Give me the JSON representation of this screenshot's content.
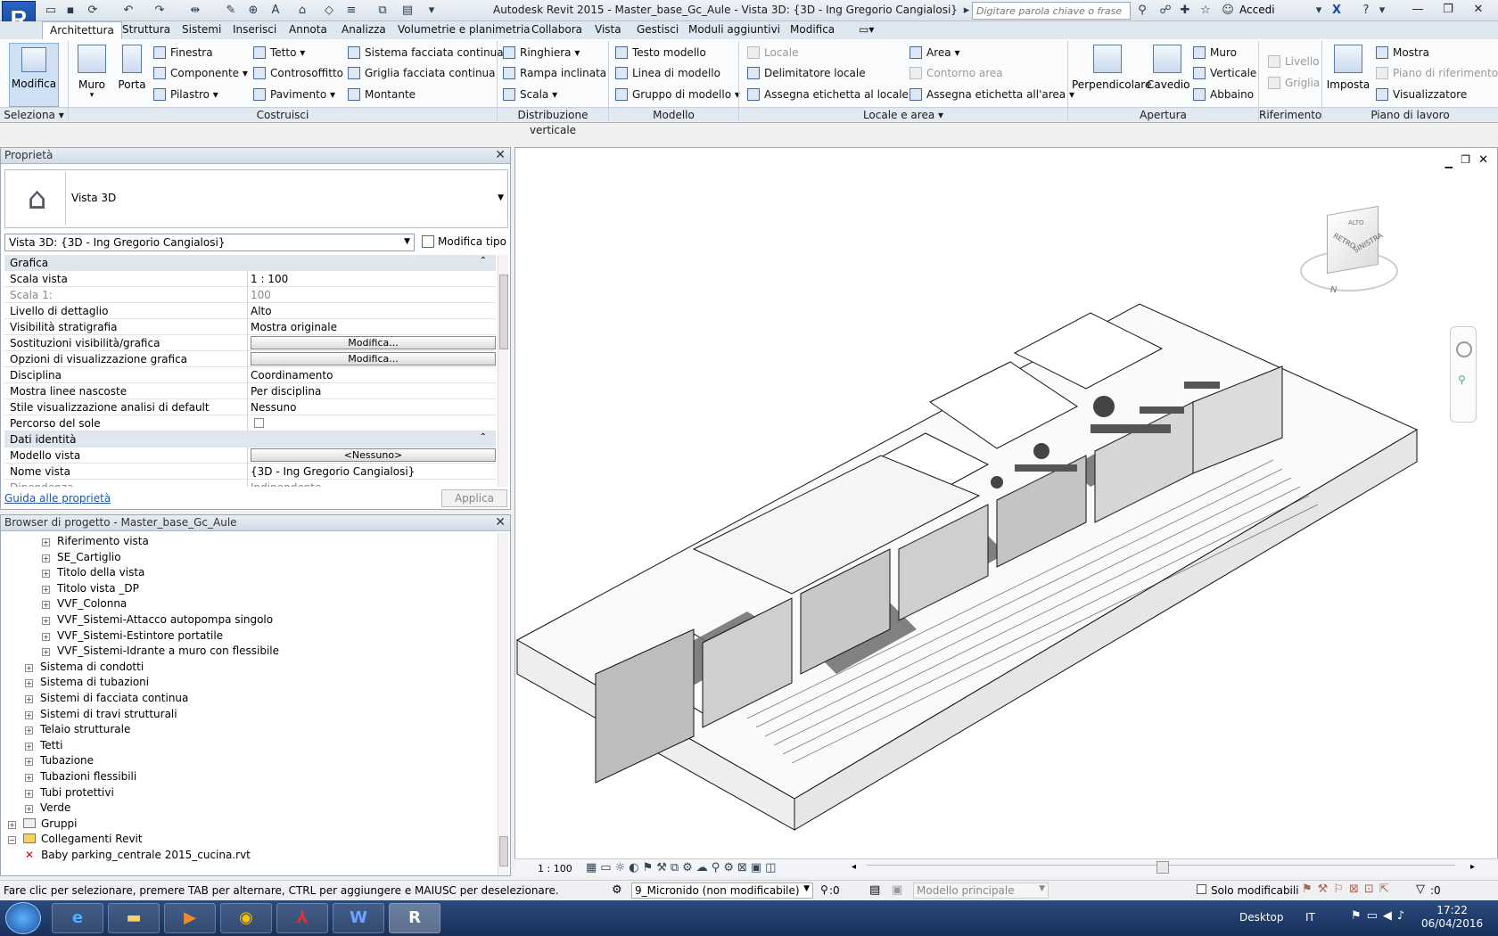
{
  "title_bar": {
    "app_title": "Autodesk Revit 2015 -    Master_base_Gc_Aule - Vista 3D: {3D - Ing Gregorio Cangialosi}",
    "search_placeholder": "Digitare parola chiave o frase",
    "signin": "Accedi"
  },
  "tabs": [
    "Architettura",
    "Struttura",
    "Sistemi",
    "Inserisci",
    "Annota",
    "Analizza",
    "Volumetrie e planimetria",
    "Collabora",
    "Vista",
    "Gestisci",
    "Moduli aggiuntivi",
    "Modifica"
  ],
  "ribbon": {
    "modifica": "Modifica",
    "muro": "Muro",
    "porta": "Porta",
    "finestra": "Finestra",
    "componente": "Componente",
    "pilastro": "Pilastro",
    "tetto": "Tetto",
    "controsoffitto": "Controsoffitto",
    "pavimento": "Pavimento",
    "sistema_facciata": "Sistema facciata continua",
    "griglia_facciata": "Griglia facciata continua",
    "montante": "Montante",
    "ringhiera": "Ringhiera",
    "rampa": "Rampa inclinata",
    "scala": "Scala",
    "testo_modello": "Testo modello",
    "linea_modello": "Linea di modello",
    "gruppo_modello": "Gruppo di modello",
    "locale": "Locale",
    "delimitatore": "Delimitatore  locale",
    "assegna_locale": "Assegna etichetta  al locale",
    "area": "Area",
    "contorno_area": "Contorno  area",
    "assegna_area": "Assegna etichetta  all'area",
    "perpendicolare": "Perpendicolare",
    "cavedio": "Cavedio",
    "ap_muro": "Muro",
    "verticale": "Verticale",
    "abbaino": "Abbaino",
    "livello": "Livello",
    "griglia": "Griglia",
    "imposta": "Imposta",
    "mostra": "Mostra",
    "piano_rif": "Piano di riferimento",
    "visualizzatore": "Visualizzatore",
    "groups": {
      "seleziona": "Seleziona",
      "costruisci": "Costruisci",
      "distribuzione": "Distribuzione verticale",
      "modello": "Modello",
      "locale_area": "Locale e area",
      "apertura": "Apertura",
      "riferimento": "Riferimento",
      "piano_lavoro": "Piano di lavoro"
    }
  },
  "properties": {
    "title": "Proprietà",
    "type_name": "Vista 3D",
    "view_selector": "Vista 3D: {3D - Ing Gregorio Cangialosi}",
    "edit_type": "Modifica tipo",
    "rows": [
      {
        "k": "Grafica",
        "v": "",
        "kind": "section"
      },
      {
        "k": "Scala vista",
        "v": "1 : 100"
      },
      {
        "k": "Scala 1:",
        "v": "100",
        "kind": "grey"
      },
      {
        "k": "Livello di dettaglio",
        "v": "Alto"
      },
      {
        "k": "Visibilità stratigrafia",
        "v": "Mostra originale"
      },
      {
        "k": "Sostituzioni visibilità/grafica",
        "v": "Modifica...",
        "kind": "button"
      },
      {
        "k": "Opzioni di visualizzazione grafica",
        "v": "Modifica...",
        "kind": "button"
      },
      {
        "k": "Disciplina",
        "v": "Coordinamento"
      },
      {
        "k": "Mostra linee nascoste",
        "v": "Per disciplina"
      },
      {
        "k": "Stile visualizzazione analisi di default",
        "v": "Nessuno"
      },
      {
        "k": "Percorso del sole",
        "v": "",
        "kind": "checkbox"
      },
      {
        "k": "Dati identità",
        "v": "",
        "kind": "section"
      },
      {
        "k": "Modello vista",
        "v": "<Nessuno>",
        "kind": "button"
      },
      {
        "k": "Nome vista",
        "v": "{3D - Ing Gregorio Cangialosi}"
      },
      {
        "k": "Dipendenza",
        "v": "Indipendente",
        "kind": "grey"
      }
    ],
    "help_link": "Guida alle proprietà",
    "apply": "Applica"
  },
  "browser": {
    "title": "Browser di progetto - Master_base_Gc_Aule",
    "items": [
      {
        "t": "Riferimento vista",
        "lvl": 2
      },
      {
        "t": "SE_Cartiglio",
        "lvl": 2
      },
      {
        "t": "Titolo della vista",
        "lvl": 2
      },
      {
        "t": "Titolo vista _DP",
        "lvl": 2
      },
      {
        "t": "VVF_Colonna",
        "lvl": 2
      },
      {
        "t": "VVF_Sistemi-Attacco autopompa singolo",
        "lvl": 2
      },
      {
        "t": "VVF_Sistemi-Estintore portatile",
        "lvl": 2
      },
      {
        "t": "VVF_Sistemi-Idrante a muro con flessibile",
        "lvl": 2
      },
      {
        "t": "Sistema di condotti",
        "lvl": 1
      },
      {
        "t": "Sistema di tubazioni",
        "lvl": 1
      },
      {
        "t": "Sistemi di facciata continua",
        "lvl": 1
      },
      {
        "t": "Sistemi di travi strutturali",
        "lvl": 1
      },
      {
        "t": "Telaio strutturale",
        "lvl": 1
      },
      {
        "t": "Tetti",
        "lvl": 1
      },
      {
        "t": "Tubazione",
        "lvl": 1
      },
      {
        "t": "Tubazioni flessibili",
        "lvl": 1
      },
      {
        "t": "Tubi protettivi",
        "lvl": 1
      },
      {
        "t": "Verde",
        "lvl": 1
      },
      {
        "t": "Gruppi",
        "lvl": 0
      },
      {
        "t": "Collegamenti Revit",
        "lvl": 0
      },
      {
        "t": "Baby parking_centrale 2015_cucina.rvt",
        "lvl": 1
      }
    ]
  },
  "viewport": {
    "scale": "1 : 100",
    "viewcube_face1": "RETRO",
    "viewcube_face2": "SINISTRA",
    "viewcube_top": "ALTO",
    "compass_n": "N"
  },
  "status": {
    "hint": "Fare clic per selezionare, premere TAB per alternare, CTRL per aggiungere e MAIUSC per deselezionare.",
    "workset": "9_Micronido (non modificabile)",
    "count": ":0",
    "model": "Modello principale",
    "solo_mod": "Solo modificabili",
    "filter_count": ":0"
  },
  "taskbar": {
    "desktop": "Desktop",
    "lang": "IT",
    "time": "17:22",
    "date": "06/04/2016"
  }
}
